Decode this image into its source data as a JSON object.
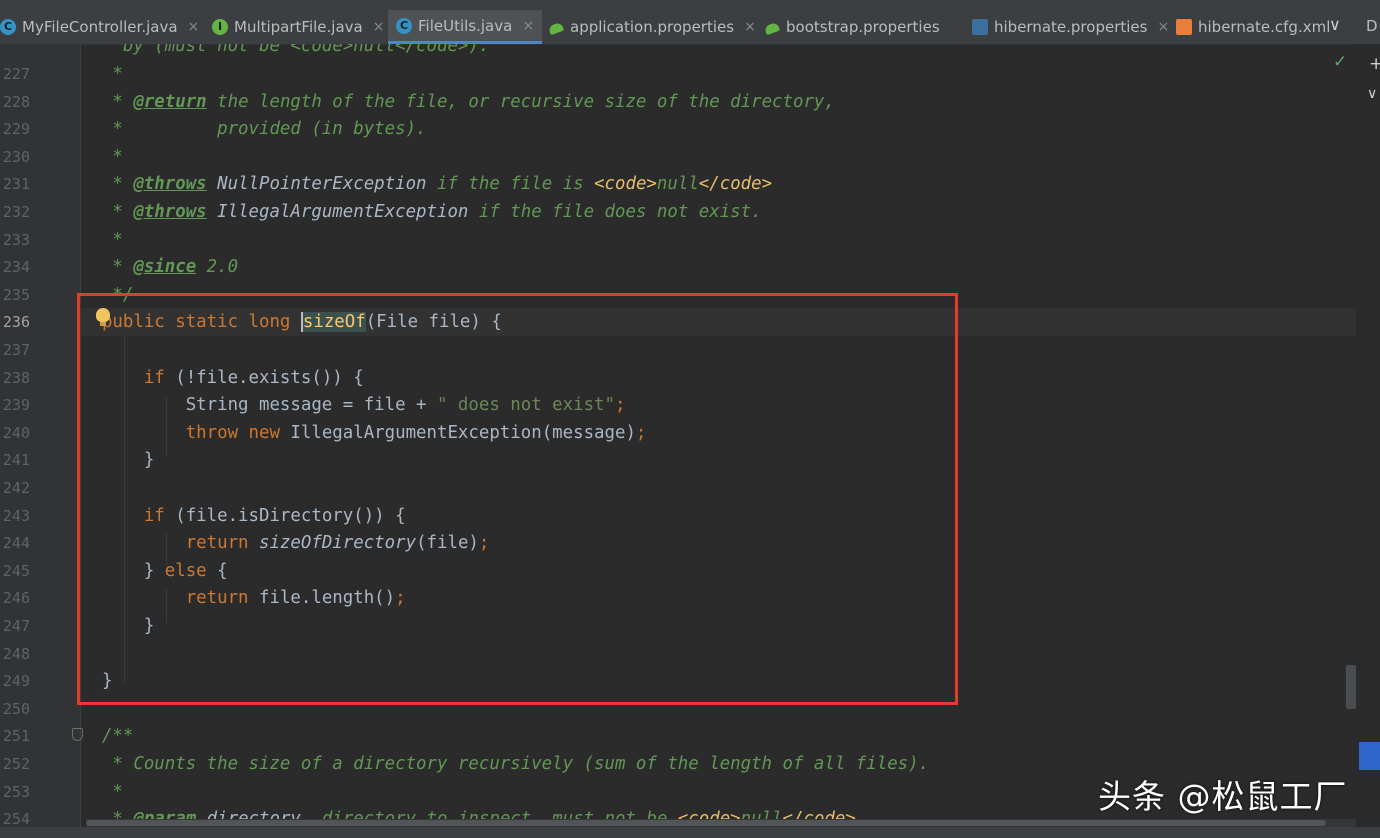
{
  "tabs": [
    {
      "label": "MyFileController.java",
      "icon": "java-class-icon",
      "close": "×",
      "active": false
    },
    {
      "label": "MultipartFile.java",
      "icon": "java-interface-icon",
      "close": "×",
      "active": false
    },
    {
      "label": "FileUtils.java",
      "icon": "java-class-icon",
      "close": "×",
      "active": true
    },
    {
      "label": "application.properties",
      "icon": "spring-properties-icon",
      "close": "×",
      "active": false
    },
    {
      "label": "bootstrap.properties",
      "icon": "spring-properties-icon",
      "close": "",
      "active": false
    },
    {
      "label": "hibernate.properties",
      "icon": "hibernate-properties-icon",
      "close": "×",
      "active": false
    },
    {
      "label": "hibernate.cfg.xml",
      "icon": "xml-file-icon",
      "close": "",
      "active": false
    }
  ],
  "tab_overflow": {
    "dropdown": "∨",
    "more": "D"
  },
  "line_numbers": [
    "227",
    "228",
    "229",
    "230",
    "231",
    "232",
    "233",
    "234",
    "235",
    "236",
    "237",
    "238",
    "239",
    "240",
    "241",
    "242",
    "243",
    "244",
    "245",
    "246",
    "247",
    "248",
    "249",
    "250",
    "251",
    "252",
    "253",
    "254"
  ],
  "current_line": "236",
  "code": {
    "l226": "    by (must not be <code>null</code>).",
    "l227_star": "   *",
    "l228_star": "   * ",
    "l228_tag": "@return",
    "l228_text": " the length of the file, or recursive size of the directory,",
    "l229": "   *         provided (in bytes).",
    "l230": "   *",
    "l231_star": "   * ",
    "l231_tag": "@throws",
    "l231_ref": " NullPointerException",
    "l231_text": " if the file is ",
    "l231_code_open": "<code>",
    "l231_null": "null",
    "l231_code_close": "</code>",
    "l232_star": "   * ",
    "l232_tag": "@throws",
    "l232_ref": " IllegalArgumentException",
    "l232_text": " if the file does not exist.",
    "l233": "   *",
    "l234_star": "   * ",
    "l234_tag": "@since",
    "l234_text": " 2.0",
    "l235": "   */",
    "l236_mods": "  public static long ",
    "l236_name": "sizeOf",
    "l236_rest": "(File file) {",
    "l238_if": "      if",
    "l238_rest": " (!file.exists()) {",
    "l239_a": "          String message = file + ",
    "l239_str": "\" does not exist\"",
    "l239_semi": ";",
    "l240_throw": "          throw new",
    "l240_rest": " IllegalArgumentException(message)",
    "l240_semi": ";",
    "l241": "      }",
    "l243_if": "      if",
    "l243_rest": " (file.isDirectory()) {",
    "l244_ret": "          return ",
    "l244_call": "sizeOfDirectory",
    "l244_rest": "(file)",
    "l244_semi": ";",
    "l245_a": "      } ",
    "l245_else": "else",
    "l245_b": " {",
    "l246_ret": "          return",
    "l246_rest": " file.length()",
    "l246_semi": ";",
    "l247": "      }",
    "l249": "  }",
    "l251": "  /**",
    "l252": "   * Counts the size of a directory recursively (sum of the length of all files).",
    "l253": "   *",
    "l254_star": "   * ",
    "l254_tag": "@param",
    "l254_ref": " directory",
    "l254_text": "  directory to inspect, must not be ",
    "l254_code_open": "<code>",
    "l254_null": "null",
    "l254_code_close": "</code>"
  },
  "watermark": "头条 @松鼠工厂",
  "colors": {
    "editor_bg": "#2b2b2b",
    "keyword": "#cc7832",
    "string": "#6a8759",
    "method_decl": "#ffc66d",
    "javadoc": "#629755",
    "highlight_box": "#e33b2e"
  }
}
